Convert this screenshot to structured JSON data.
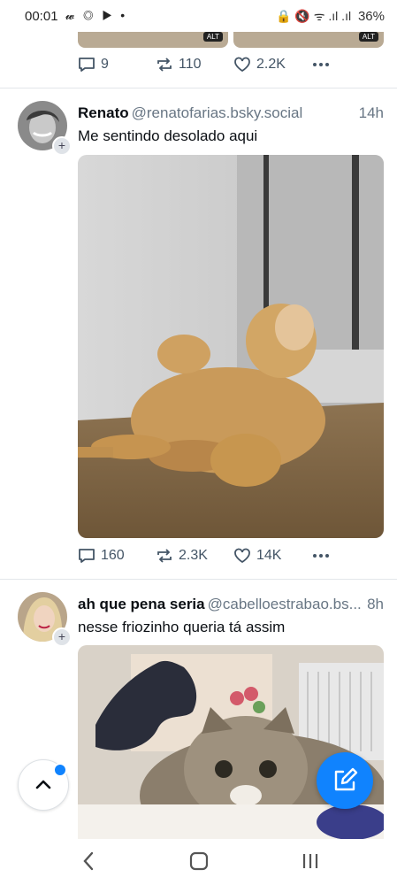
{
  "status_bar": {
    "time": "00:01",
    "left_icons": "𝔀 ◎ ▶ •",
    "right_icons": "🔒 🔇 ᯤ .ıl .ıl",
    "battery": "36%"
  },
  "previous_post": {
    "alt_labels": [
      "ALT",
      "ALT"
    ],
    "replies": "9",
    "reposts": "110",
    "likes": "2.2K",
    "more_icon": "more-horizontal-icon"
  },
  "posts": [
    {
      "author": "Renato",
      "handle": "@renatofarias.bsky.social",
      "time": "14h",
      "text": "Me sentindo desolado aqui",
      "media": "gif",
      "replies": "160",
      "reposts": "2.3K",
      "likes": "14K"
    },
    {
      "author": "ah que pena seria",
      "handle": "@cabelloestrabao.bs...",
      "time": "8h",
      "text": "nesse friozinho queria tá assim",
      "media": "gif"
    }
  ],
  "colors": {
    "accent": "#1083fe",
    "muted_text": "#687684",
    "action_icons": "#445566",
    "divider": "#e3e6ea"
  },
  "icons": {
    "reply": "speech-bubble-icon",
    "repost": "repost-arrows-icon",
    "like": "heart-icon",
    "more": "ellipsis-icon",
    "scroll_top": "chevron-up-icon",
    "compose": "compose-pencil-icon",
    "nav_back": "chevron-left-icon",
    "nav_home": "rounded-square-icon",
    "nav_recents": "three-bars-icon"
  }
}
